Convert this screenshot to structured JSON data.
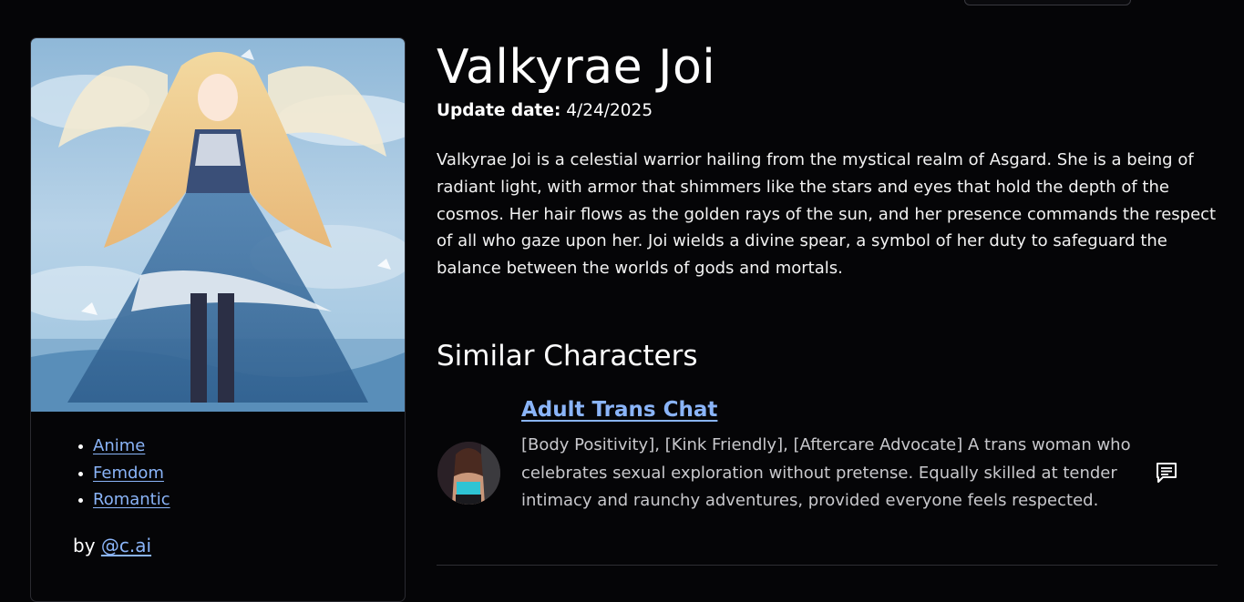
{
  "character": {
    "name": "Valkyrae Joi",
    "update_label": "Update date:",
    "update_value": "4/24/2025",
    "description": "Valkyrae Joi is a celestial warrior hailing from the mystical realm of Asgard. She is a being of radiant light, with armor that shimmers like the stars and eyes that hold the depth of the cosmos. Her hair flows as the golden rays of the sun, and her presence commands the respect of all who gaze upon her. Joi wields a divine spear, a symbol of her duty to safeguard the balance between the worlds of gods and mortals."
  },
  "sidebar": {
    "tags": [
      {
        "label": "Anime"
      },
      {
        "label": "Femdom"
      },
      {
        "label": "Romantic"
      }
    ],
    "by_prefix": "by",
    "author": "@c.ai"
  },
  "similar": {
    "heading": "Similar Characters",
    "items": [
      {
        "name": "Adult Trans Chat",
        "description": "[Body Positivity], [Kink Friendly], [Aftercare Advocate] A trans woman who celebrates sexual exploration without pretense. Equally skilled at tender intimacy and raunchy adventures, provided everyone feels respected.",
        "action_icon": "chat-icon"
      }
    ]
  },
  "colors": {
    "background": "#050507",
    "link": "#8ab4f8",
    "border": "#2a2a30"
  }
}
